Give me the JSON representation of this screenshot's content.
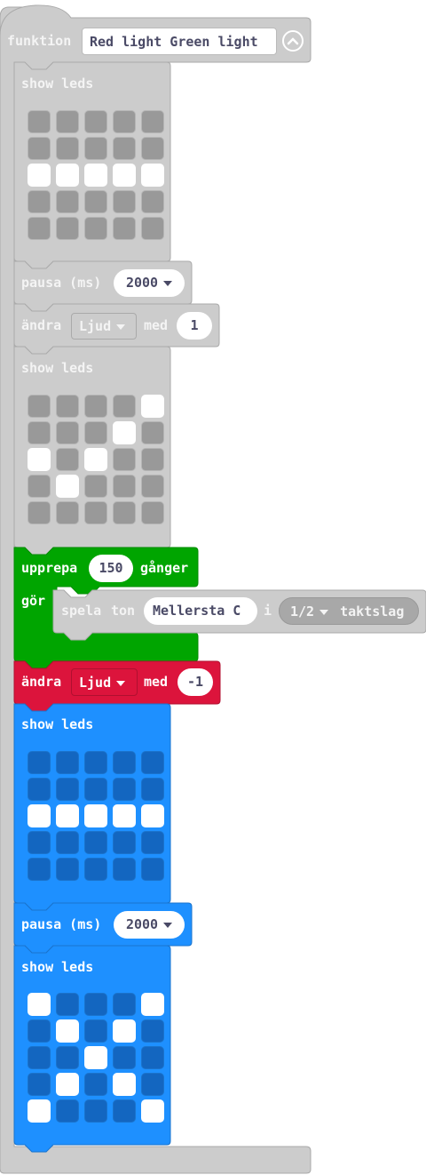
{
  "function_block": {
    "keyword": "funktion",
    "name": "Red light Green light",
    "collapse_icon": "chevron-up-circle-icon",
    "color": "#cccccc"
  },
  "blocks": [
    {
      "type": "show_leds",
      "label": "show leds",
      "leds": [
        [
          0,
          0,
          0,
          0,
          0
        ],
        [
          0,
          0,
          0,
          0,
          0
        ],
        [
          1,
          1,
          1,
          1,
          1
        ],
        [
          0,
          0,
          0,
          0,
          0
        ],
        [
          0,
          0,
          0,
          0,
          0
        ]
      ]
    },
    {
      "type": "pause",
      "label": "pausa (ms)",
      "value": "2000"
    },
    {
      "type": "change_var",
      "label": "ändra",
      "variable": "Ljud",
      "by": "med",
      "value": "1"
    },
    {
      "type": "show_leds",
      "label": "show leds",
      "leds": [
        [
          0,
          0,
          0,
          0,
          1
        ],
        [
          0,
          0,
          0,
          1,
          0
        ],
        [
          1,
          0,
          1,
          0,
          0
        ],
        [
          0,
          1,
          0,
          0,
          0
        ],
        [
          0,
          0,
          0,
          0,
          0
        ]
      ]
    },
    {
      "type": "repeat",
      "label": "upprepa",
      "count": "150",
      "times": "gånger",
      "do": "gör",
      "inner": {
        "label_play": "spela",
        "label_tone": "ton",
        "note": "Mellersta C",
        "in": "i",
        "beat": "1/2",
        "beat_unit": "taktslag"
      }
    },
    {
      "type": "change_var",
      "label": "ändra",
      "variable": "Ljud",
      "by": "med",
      "value": "-1"
    },
    {
      "type": "show_leds",
      "label": "show leds",
      "leds": [
        [
          0,
          0,
          0,
          0,
          0
        ],
        [
          0,
          0,
          0,
          0,
          0
        ],
        [
          1,
          1,
          1,
          1,
          1
        ],
        [
          0,
          0,
          0,
          0,
          0
        ],
        [
          0,
          0,
          0,
          0,
          0
        ]
      ]
    },
    {
      "type": "pause",
      "label": "pausa (ms)",
      "value": "2000"
    },
    {
      "type": "show_leds",
      "label": "show leds",
      "leds": [
        [
          1,
          0,
          0,
          0,
          1
        ],
        [
          0,
          1,
          0,
          1,
          0
        ],
        [
          0,
          0,
          1,
          0,
          0
        ],
        [
          0,
          1,
          0,
          1,
          0
        ],
        [
          1,
          0,
          0,
          0,
          1
        ]
      ]
    }
  ],
  "colors": {
    "disabled_block": "#cccccc",
    "disabled_led_off": "#999999",
    "loop_green": "#00a500",
    "variable_red": "#dc143c",
    "basic_blue": "#1e90ff",
    "blue_led_off": "#1366c0",
    "led_on": "#ffffff"
  }
}
